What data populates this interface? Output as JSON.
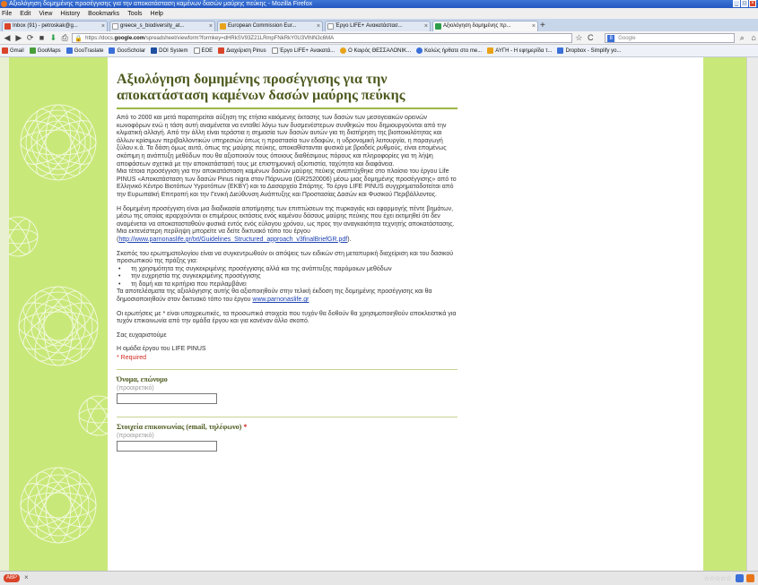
{
  "window": {
    "title": "Αξιολόγηση δομημένης προσέγγισης για την αποκατάσταση καμένων δασών μαύρης πεύκης - Mozilla Firefox"
  },
  "menu": [
    "File",
    "Edit",
    "View",
    "History",
    "Bookmarks",
    "Tools",
    "Help"
  ],
  "tabs": [
    {
      "label": "Inbox (91) - petroskak@g...",
      "active": false
    },
    {
      "label": "greece_s_biodiversity_at...",
      "active": false
    },
    {
      "label": "European Commission Eur...",
      "active": false
    },
    {
      "label": "Έργο LIFE+ Ανακατάστασ...",
      "active": false
    },
    {
      "label": "Αξιολόγηση δομημένης πρ...",
      "active": true
    }
  ],
  "nav": {
    "url_prefix": "https://docs.",
    "url_domain": "google.com",
    "url_suffix": "/spreadsheet/viewform?formkey=dHRkSV93Z21LRmpFNkRkY0U3VlhlN3c6MA",
    "search_placeholder": "Google"
  },
  "bookmarks": [
    {
      "label": "Gmail",
      "color": "#d9442a"
    },
    {
      "label": "GooMaps",
      "color": "#4a9e3a"
    },
    {
      "label": "GooTraslate",
      "color": "#3b6fd9"
    },
    {
      "label": "GooScholar",
      "color": "#3b6fd9"
    },
    {
      "label": "DOI System",
      "color": "#1f4fa0"
    },
    {
      "label": "EOE",
      "color": "#888888"
    },
    {
      "label": "Διαχείριση Pinus",
      "color": "#d9442a"
    },
    {
      "label": "Έργο LIFE+ Ανακατά...",
      "color": "#888888"
    },
    {
      "label": "Ο Καιρός ΘΕΣΣΑΛΟΝΙΚ...",
      "color": "#e8a31a"
    },
    {
      "label": "Καλώς ήρθατε στο me...",
      "color": "#3b6fd9"
    },
    {
      "label": "ΑΥΓΗ - Η εφημερίδα τ...",
      "color": "#e8a31a"
    },
    {
      "label": "Dropbox - Simplify yo...",
      "color": "#3b6fd9"
    }
  ],
  "form": {
    "title": "Αξιολόγηση δομημένης προσέγγισης για την αποκατάσταση καμένων δασών μαύρης πεύκης",
    "p1": "Από το 2000 και μετά παρατηρείται αύξηση της ετήσια καιόμενης έκτασης των δασών των μεσογειακών ορεινών κωνοφόρων ενώ η τάση αυτή αναμένεται να ενταθεί λόγω των δυσμενέστερων συνθηκών που δημιουργούνται από την κλιματική αλλαγή. Από την άλλη είναι τεράστια η σημασία των δασών αυτών για τη διατήρηση της βιοποικιλότητας και άλλων κρίσιμων περιβαλλοντικών υπηρεσιών όπως η προστασία των εδαφών, η υδρονομική λειτουργία, η παραγωγή ξύλου κ.ά. Τα δάση όμως αυτά, όπως της μαύρης πεύκης, αποκαθίστανται φυσικά με βραδείς ρυθμούς, είναι επομένως σκόπιμη η ανάπτυξη μεθόδων που θα αξιοποιούν τους όποιους διαθέσιμους πόρους και πληροφορίες για τη λήψη αποφάσεων σχετικά με την αποκατάστασή τους με επιστημονική αξιοπιστία, ταχύτητα και διαφάνεια.",
    "p1b": "Μια τέτοια προσέγγιση για την αποκατάσταση καμένων δασών μαύρης πεύκης αναπτύχθηκε στο πλαίσιο του έργου Life PINUS «Αποκατάσταση των δασών Pinus nigra στον Πάρνωνα (GR2520006) μέσω μιας δομημένης προσέγγισης» από το Ελληνικό Κέντρο Βιοτόπων Υγροτόπων (ΕΚΒΥ) και το Δασαρχείο Σπάρτης. Το έργο LIFE PINUS συγχρηματοδοτείται από την Ευρωπαϊκή Επιτροπή και την Γενική Διεύθυνση Ανάπτυξης και Προστασίας Δασών και Φυσικού Περιβάλλοντος.",
    "p2": "Η δομημένη προσέγγιση είναι μια διαδικασία αποτίμησης των επιπτώσεων της πυρκαγιάς και εφαρμογής πέντε βημάτων, μέσω της οποίας ιεραρχούνται οι επιμέρους εκτάσεις ενός καμένου δάσους μαύρης πεύκης που έχει εκτιμηθεί ότι δεν αναμένεται να αποκατασταθούν φυσικά εντός ενός εύλογου χρόνου, ως προς την αναγκαιότητα τεχνητής αποκατάστασης.",
    "p2b_pre": "Μια εκτενέστερη περίληψη μπορείτε να δείτε δικτυακό τόπο του έργου (",
    "p2b_link": "http://www.parnonaslife.gr/txt/Guidelines_Structured_approach_v3finalBriefGR.pdf",
    "p2b_post": ").",
    "p3": "Σκοπός του ερωτηματολογίου είναι να συγκεντρωθούν οι απόψεις των ειδικών στη μεταπυρική διαχείριση και του δασικού προσωπικού της πράξης για:",
    "bullets": [
      "τη χρησιμότητα της συγκεκριμένης προσέγγισης αλλά και της  ανάπτυξης παρόμοιων μεθόδων",
      "την ευχρηστία της συγκεκριμένης προσέγγισης",
      "τη δομή και τα κριτήρια που περιλαμβάνει"
    ],
    "p3b_pre": "Τα αποτελέσματα της αξιολόγησης αυτής θα αξιοποιηθούν στην τελική έκδοση της δομημένης προσέγγισης και θα δημοσιοποιηθούν στον δικτυακό τόπο του έργου ",
    "p3b_link": "www.parnonaslife.gr",
    "p4": "Οι ερωτήσεις με * είναι υποχρεωτικές, τα προσωπικά στοιχεία που τυχόν θα δοθούν θα χρησιμοποιηθούν αποκλειστικά για τυχόν επικοινωνία από την ομάδα έργου και για κανέναν άλλο σκοπό.",
    "thanks": "Σας ευχαριστούμε",
    "signature": "Η ομάδα έργου του LIFE PINUS",
    "required_note": "* Required",
    "q1_label": "Όνομα, επώνυμο",
    "q1_help": "(προαιρετικό)",
    "q2_label": "Στοιχεία επικοινωνίας (email, τηλέφωνο)",
    "q2_star": "*",
    "q2_help": "(προαιρετικό)"
  },
  "status": {
    "addon": "ABP"
  }
}
